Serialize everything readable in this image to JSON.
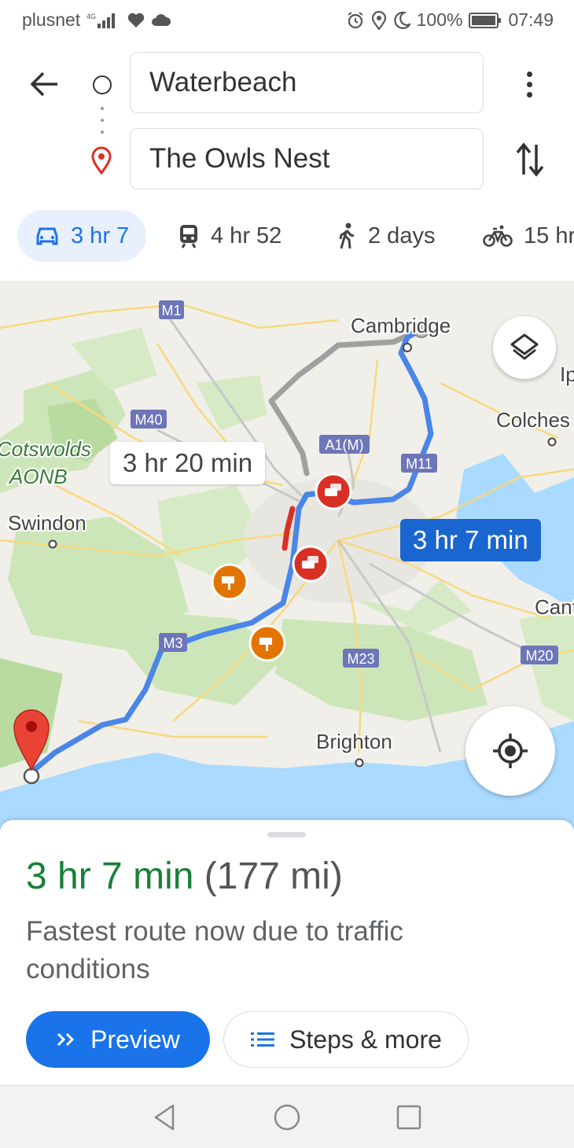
{
  "status_bar": {
    "carrier": "plusnet",
    "network": "4G",
    "battery": "100%",
    "time": "07:49"
  },
  "directions": {
    "origin": "Waterbeach",
    "destination": "The Owls Nest"
  },
  "modes": [
    {
      "icon": "car-icon",
      "label": "3 hr 7",
      "active": true
    },
    {
      "icon": "train-icon",
      "label": "4 hr 52",
      "active": false
    },
    {
      "icon": "walking-icon",
      "label": "2 days",
      "active": false
    },
    {
      "icon": "bicycle-icon",
      "label": "15 hr",
      "active": false
    }
  ],
  "map": {
    "place_labels": [
      "Cambridge",
      "Colches",
      "Ip",
      "Cotswolds",
      "AONB",
      "Swindon",
      "Brighton",
      "Cant"
    ],
    "road_labels": [
      "M1",
      "M40",
      "A1(M)",
      "M11",
      "M3",
      "M23",
      "M20"
    ],
    "alt_route_time": "3 hr 20 min",
    "main_route_time": "3 hr 7 min"
  },
  "sheet": {
    "duration": "3 hr 7 min",
    "distance": "(177 mi)",
    "description": "Fastest route now due to traffic conditions",
    "preview_label": "Preview",
    "steps_label": "Steps & more"
  },
  "colors": {
    "accent": "#1a73e8",
    "route": "#4a86e8",
    "duration_green": "#188038",
    "traffic_red": "#d93025",
    "camera_orange": "#e37400"
  }
}
